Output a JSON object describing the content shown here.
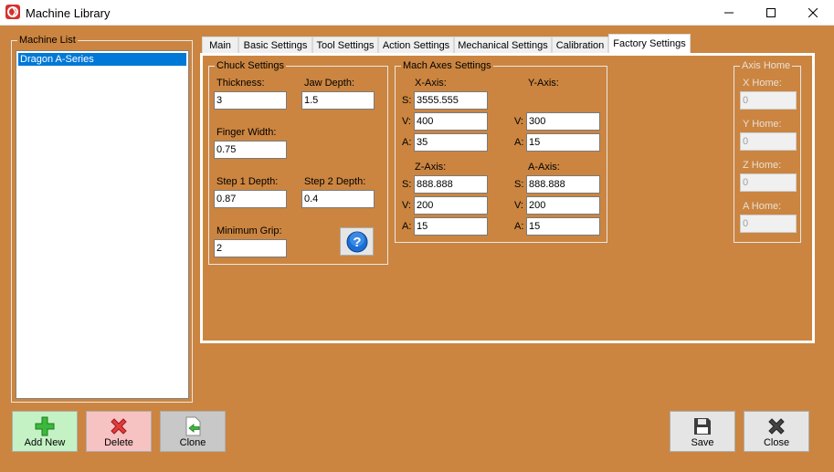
{
  "window": {
    "title": "Machine Library",
    "controls": {
      "minimize": "minimize-icon",
      "maximize": "maximize-icon",
      "close": "close-icon"
    }
  },
  "machine_list": {
    "title": "Machine List",
    "items": [
      "Dragon A-Series"
    ],
    "selected_index": 0
  },
  "tabs": {
    "items": [
      "Main",
      "Basic Settings",
      "Tool Settings",
      "Action Settings",
      "Mechanical Settings",
      "Calibration",
      "Factory Settings"
    ],
    "active": "Factory Settings"
  },
  "chuck_settings": {
    "title": "Chuck Settings",
    "thickness_label": "Thickness:",
    "thickness_value": "3",
    "jaw_depth_label": "Jaw Depth:",
    "jaw_depth_value": "1.5",
    "finger_width_label": "Finger Width:",
    "finger_width_value": "0.75",
    "step1_label": "Step 1 Depth:",
    "step1_value": "0.87",
    "step2_label": "Step 2 Depth:",
    "step2_value": "0.4",
    "min_grip_label": "Minimum Grip:",
    "min_grip_value": "2",
    "help_icon": "help-icon"
  },
  "mach_axes": {
    "title": "Mach Axes Settings",
    "x_axis": {
      "label": "X-Axis:",
      "s_label": "S:",
      "s_value": "3555.555",
      "v_label": "V:",
      "v_value": "400",
      "a_label": "A:",
      "a_value": "35"
    },
    "y_axis": {
      "label": "Y-Axis:",
      "v_label": "V:",
      "v_value": "300",
      "a_label": "A:",
      "a_value": "15"
    },
    "z_axis": {
      "label": "Z-Axis:",
      "s_label": "S:",
      "s_value": "888.888",
      "v_label": "V:",
      "v_value": "200",
      "a_label": "A:",
      "a_value": "15"
    },
    "a_axis": {
      "label": "A-Axis:",
      "s_label": "S:",
      "s_value": "888.888",
      "v_label": "V:",
      "v_value": "200",
      "a_label": "A:",
      "a_value": "15"
    }
  },
  "axis_home": {
    "title": "Axis Home",
    "x_label": "X Home:",
    "x_value": "0",
    "y_label": "Y Home:",
    "y_value": "0",
    "z_label": "Z Home:",
    "z_value": "0",
    "a_label": "A Home:",
    "a_value": "0"
  },
  "buttons": {
    "add_new": {
      "label": "Add New",
      "icon": "plus-icon",
      "bg": "#c5f2c5"
    },
    "delete": {
      "label": "Delete",
      "icon": "x-icon",
      "bg": "#f7c2c2"
    },
    "clone": {
      "label": "Clone",
      "icon": "clone-icon",
      "bg": "#c8c8c8"
    },
    "save": {
      "label": "Save",
      "icon": "floppy-disk-icon",
      "bg": "#e5e5e5"
    },
    "close": {
      "label": "Close",
      "icon": "close-x-icon",
      "bg": "#e5e5e5"
    }
  },
  "colors": {
    "window_bg": "#cb8540",
    "selection": "#0078d7",
    "panel_border": "#ffffff"
  }
}
